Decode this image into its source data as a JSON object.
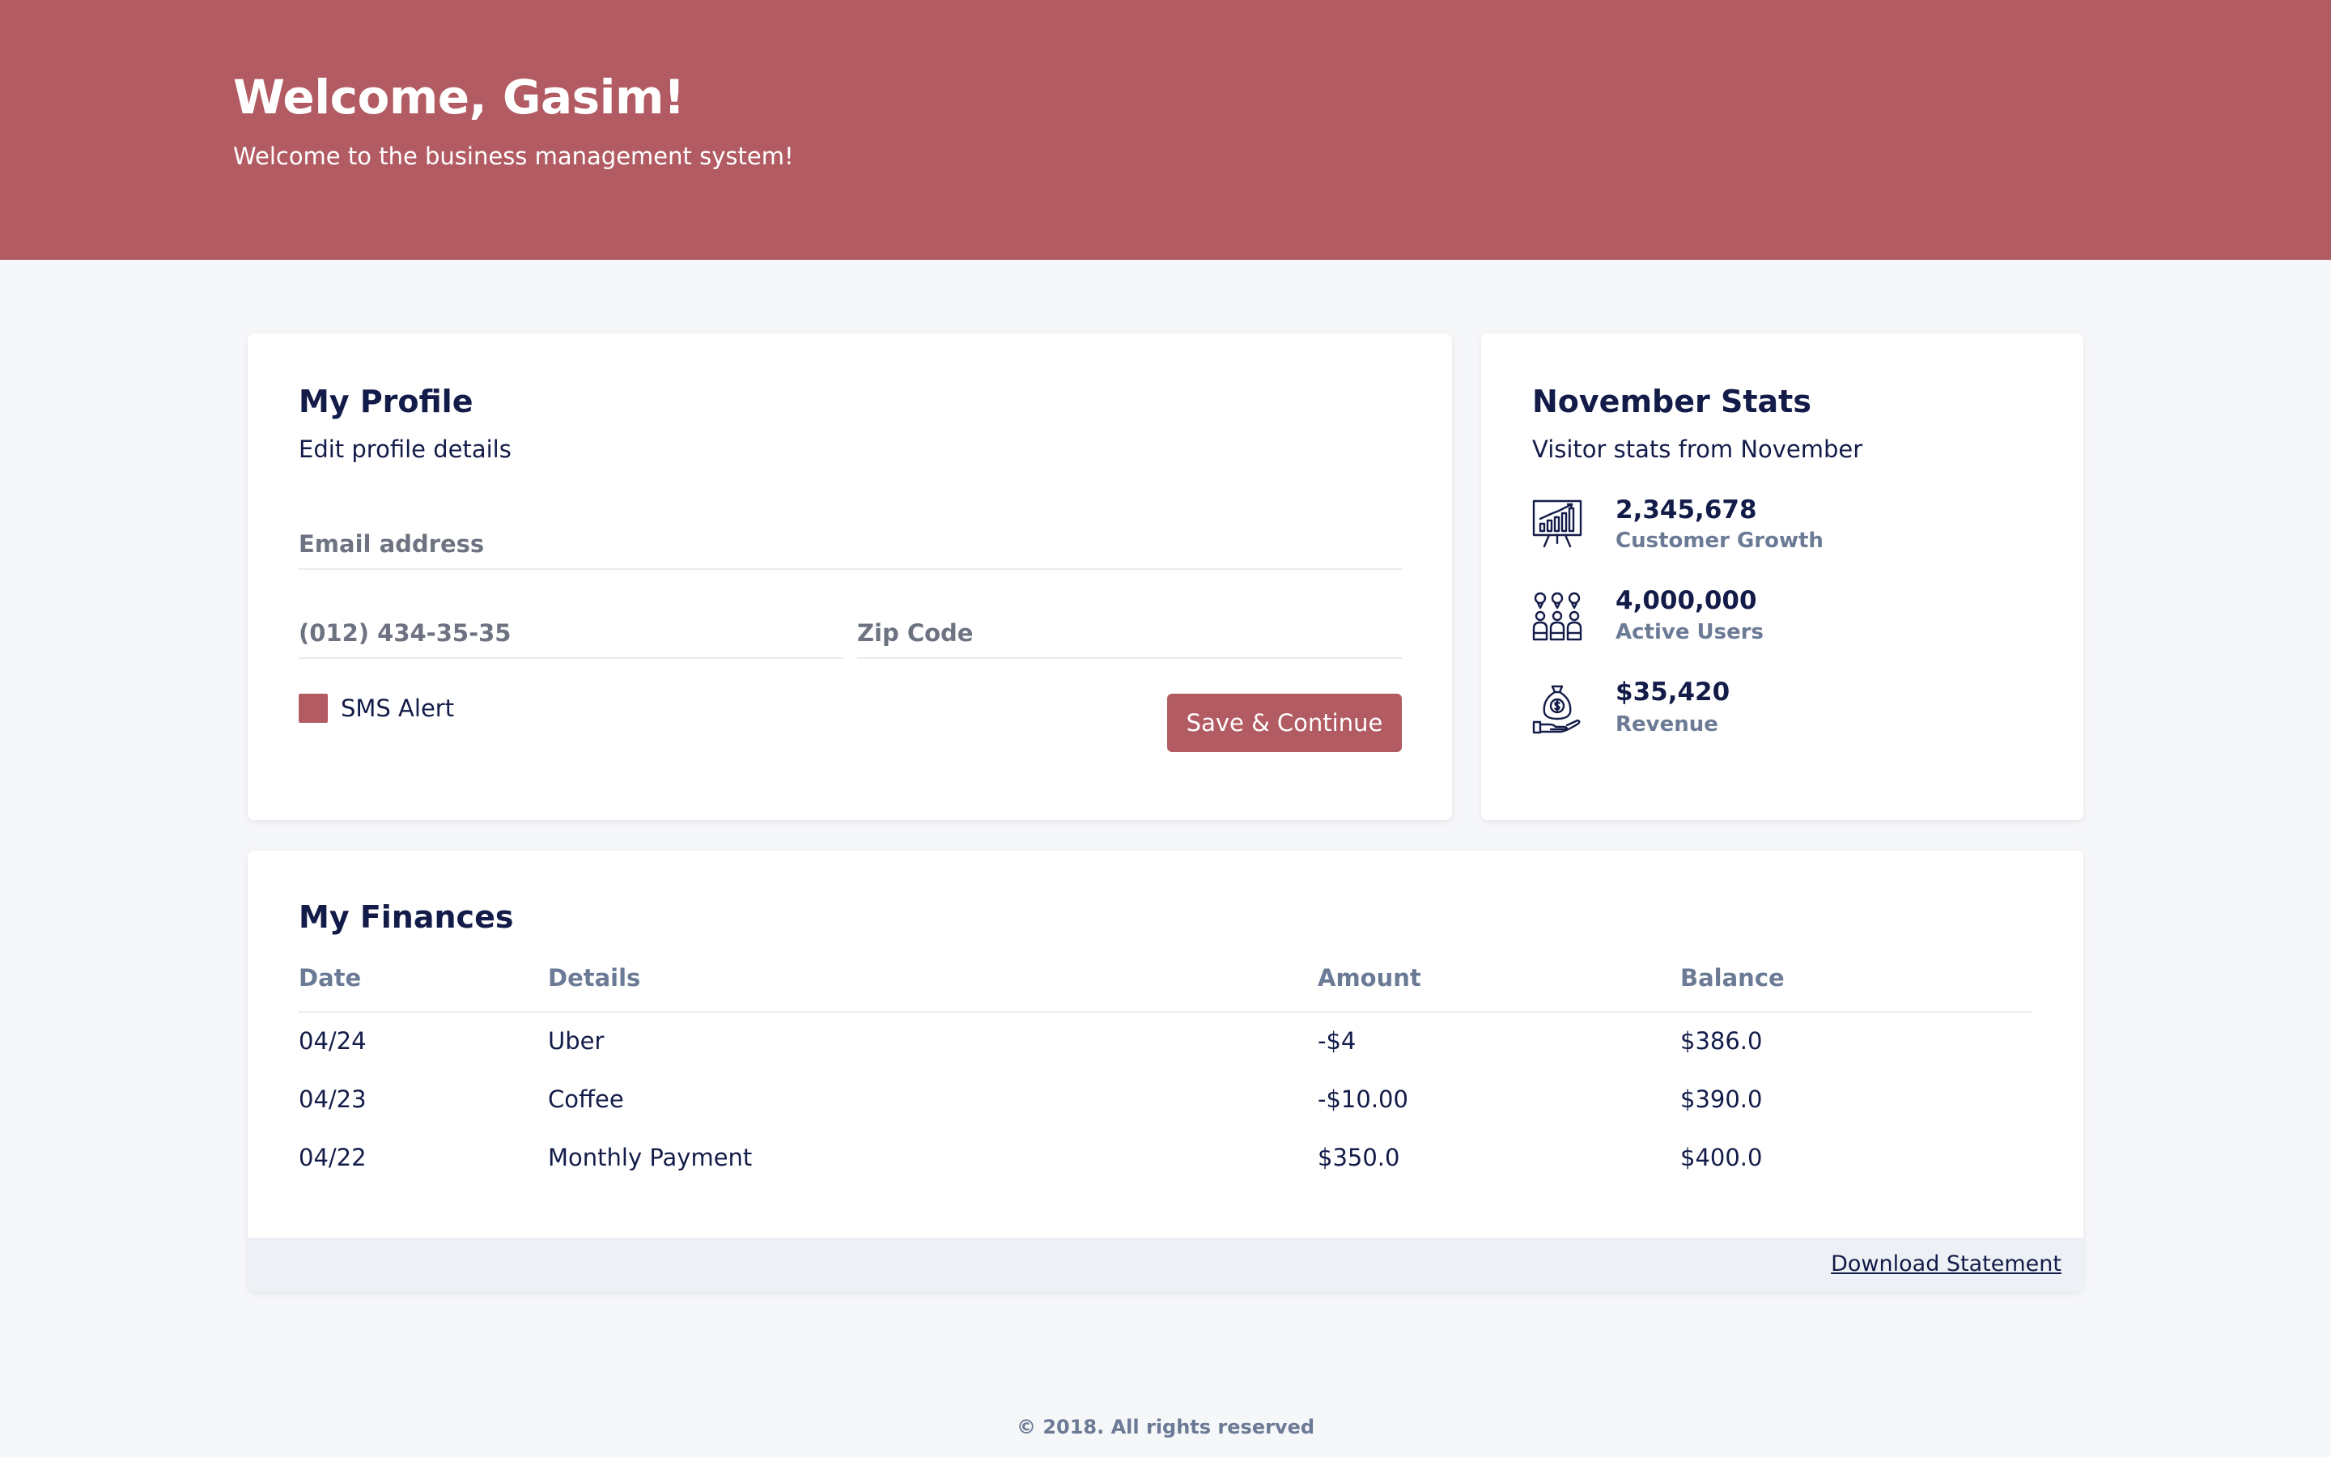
{
  "header": {
    "title": "Welcome, Gasim!",
    "subtitle": "Welcome to the business management system!"
  },
  "profile": {
    "title": "My Profile",
    "subtitle": "Edit profile details",
    "email_placeholder": "Email address",
    "email_value": "",
    "phone_placeholder": "(012) 434-35-35",
    "phone_value": "",
    "zip_placeholder": "Zip Code",
    "zip_value": "",
    "sms_alert_label": "SMS Alert",
    "sms_alert_checked": true,
    "save_label": "Save & Continue"
  },
  "stats": {
    "title": "November Stats",
    "subtitle": "Visitor stats from November",
    "items": [
      {
        "value": "2,345,678",
        "label": "Customer Growth",
        "icon": "growth-chart-icon"
      },
      {
        "value": "4,000,000",
        "label": "Active Users",
        "icon": "users-group-icon"
      },
      {
        "value": "$35,420",
        "label": "Revenue",
        "icon": "money-bag-hand-icon"
      }
    ]
  },
  "finances": {
    "title": "My Finances",
    "columns": [
      "Date",
      "Details",
      "Amount",
      "Balance"
    ],
    "rows": [
      [
        "04/24",
        "Uber",
        "-$4",
        "$386.0"
      ],
      [
        "04/23",
        "Coffee",
        "-$10.00",
        "$390.0"
      ],
      [
        "04/22",
        "Monthly Payment",
        "$350.0",
        "$400.0"
      ]
    ],
    "download_label": "Download Statement"
  },
  "footer": {
    "copyright": "© 2018. All rights reserved"
  },
  "colors": {
    "accent": "#b25b63",
    "heading": "#131c49",
    "muted": "#6b7a95",
    "background": "#f6f7f9",
    "footer_bar": "#edf0f4"
  }
}
